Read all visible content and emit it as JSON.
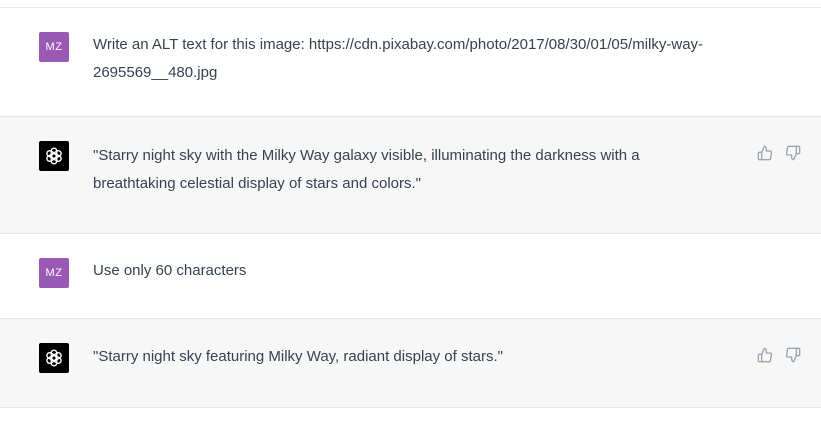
{
  "messages": [
    {
      "role": "user",
      "avatar_initials": "MZ",
      "text": "Write an ALT text for this image: https://cdn.pixabay.com/photo/2017/08/30/01/05/milky-way-2695569__480.jpg"
    },
    {
      "role": "assistant",
      "avatar_icon": "openai-logo-icon",
      "text": "\"Starry night sky with the Milky Way galaxy visible, illuminating the darkness with a breathtaking celestial display of stars and colors.\""
    },
    {
      "role": "user",
      "avatar_initials": "MZ",
      "text": "Use only 60 characters"
    },
    {
      "role": "assistant",
      "avatar_icon": "openai-logo-icon",
      "text": "\"Starry night sky featuring Milky Way, radiant display of stars.\""
    }
  ],
  "icons": {
    "thumbs_up": "thumbs-up-icon",
    "thumbs_down": "thumbs-down-icon"
  },
  "colors": {
    "user_avatar": "#9b59b6",
    "assistant_avatar": "#000000",
    "assistant_bg": "#f7f7f8",
    "text": "#374151",
    "icon": "#9ca3af"
  }
}
